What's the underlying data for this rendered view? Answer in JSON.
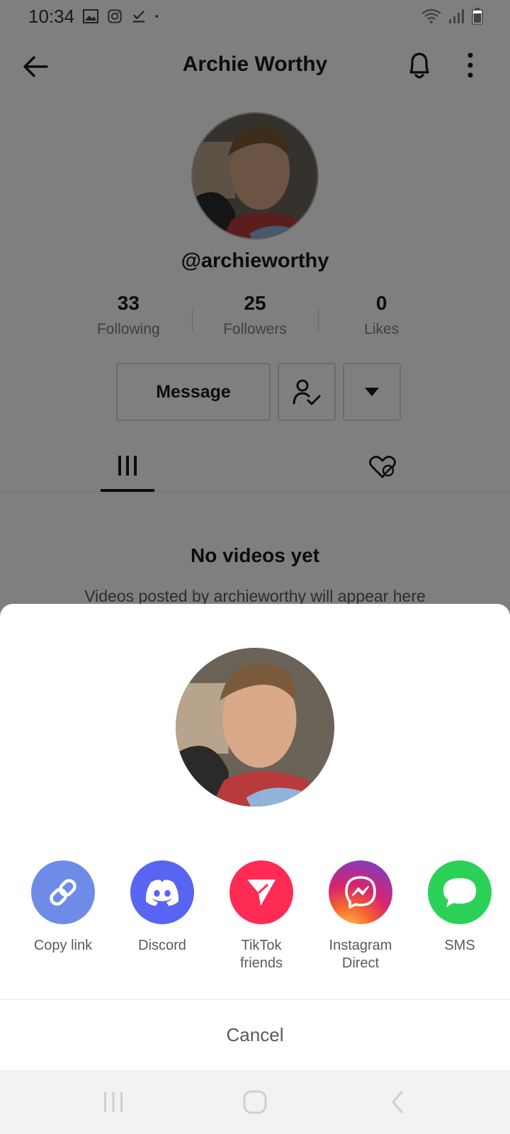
{
  "status_bar": {
    "time": "10:34"
  },
  "header": {
    "title": "Archie Worthy"
  },
  "profile": {
    "username": "@archieworthy",
    "stats": [
      {
        "value": "33",
        "label": "Following"
      },
      {
        "value": "25",
        "label": "Followers"
      },
      {
        "value": "0",
        "label": "Likes"
      }
    ],
    "message_label": "Message"
  },
  "empty_state": {
    "title": "No videos yet",
    "subtitle": "Videos posted by archieworthy will appear here"
  },
  "share_sheet": {
    "options": [
      {
        "label": "Copy link",
        "icon": "link-icon",
        "color": "#6F8BE8"
      },
      {
        "label": "Discord",
        "icon": "discord-icon",
        "color": "#5865F2"
      },
      {
        "label": "TikTok friends",
        "icon": "send-icon",
        "color": "#FE2C55"
      },
      {
        "label": "Instagram Direct",
        "icon": "messenger-icon",
        "color": "#C13584"
      },
      {
        "label": "SMS",
        "icon": "chat-bubble-icon",
        "color": "#2BD157"
      }
    ],
    "cancel_label": "Cancel"
  }
}
